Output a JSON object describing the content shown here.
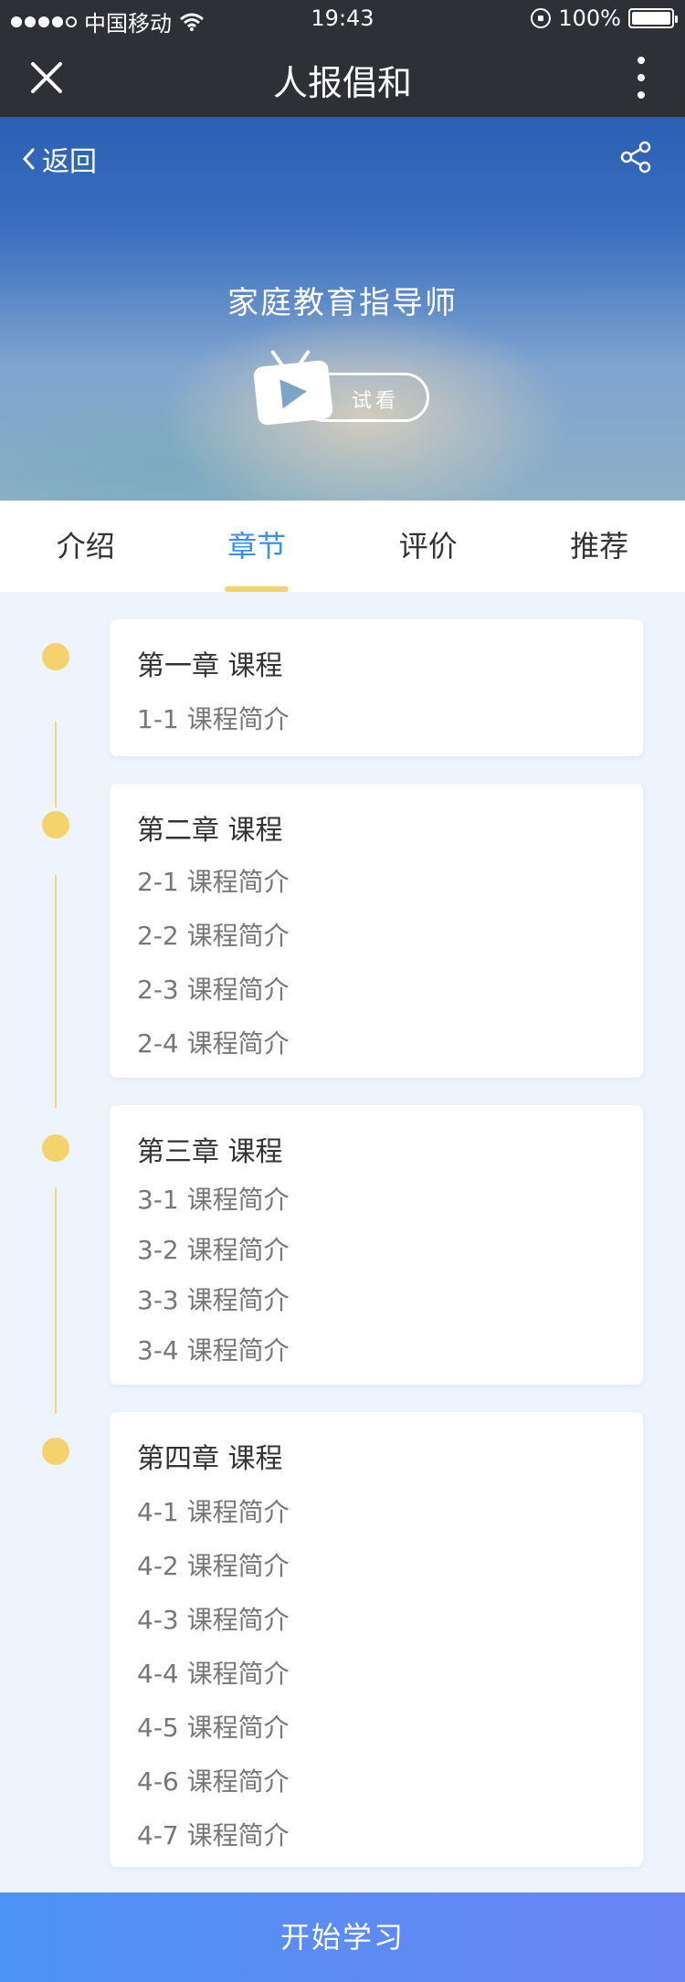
{
  "status_bar": {
    "carrier": "中国移动",
    "time": "19:43",
    "battery": "100%"
  },
  "nav": {
    "title": "人报倡和"
  },
  "hero": {
    "back_label": "返回",
    "course_title": "家庭教育指导师",
    "trial_label": "试看"
  },
  "tabs": [
    {
      "label": "介绍"
    },
    {
      "label": "章节"
    },
    {
      "label": "评价"
    },
    {
      "label": "推荐"
    }
  ],
  "active_tab": "章节",
  "chapters": [
    {
      "title": "第一章 课程",
      "lessons": [
        "1-1 课程简介"
      ]
    },
    {
      "title": "第二章 课程",
      "lessons": [
        "2-1 课程简介",
        "2-2 课程简介",
        "2-3 课程简介",
        "2-4 课程简介"
      ]
    },
    {
      "title": "第三章 课程",
      "lessons": [
        "3-1 课程简介",
        "3-2 课程简介",
        "3-3 课程简介",
        "3-4 课程简介"
      ]
    },
    {
      "title": "第四章 课程",
      "lessons": [
        "4-1 课程简介",
        "4-2 课程简介",
        "4-3 课程简介",
        "4-4 课程简介",
        "4-5 课程简介",
        "4-6 课程简介",
        "4-7 课程简介"
      ]
    }
  ],
  "start_button": "开始学习",
  "colors": {
    "accent_blue": "#3d8cf0",
    "timeline_yellow": "#f5d36c",
    "header_dark": "#2e3036"
  }
}
